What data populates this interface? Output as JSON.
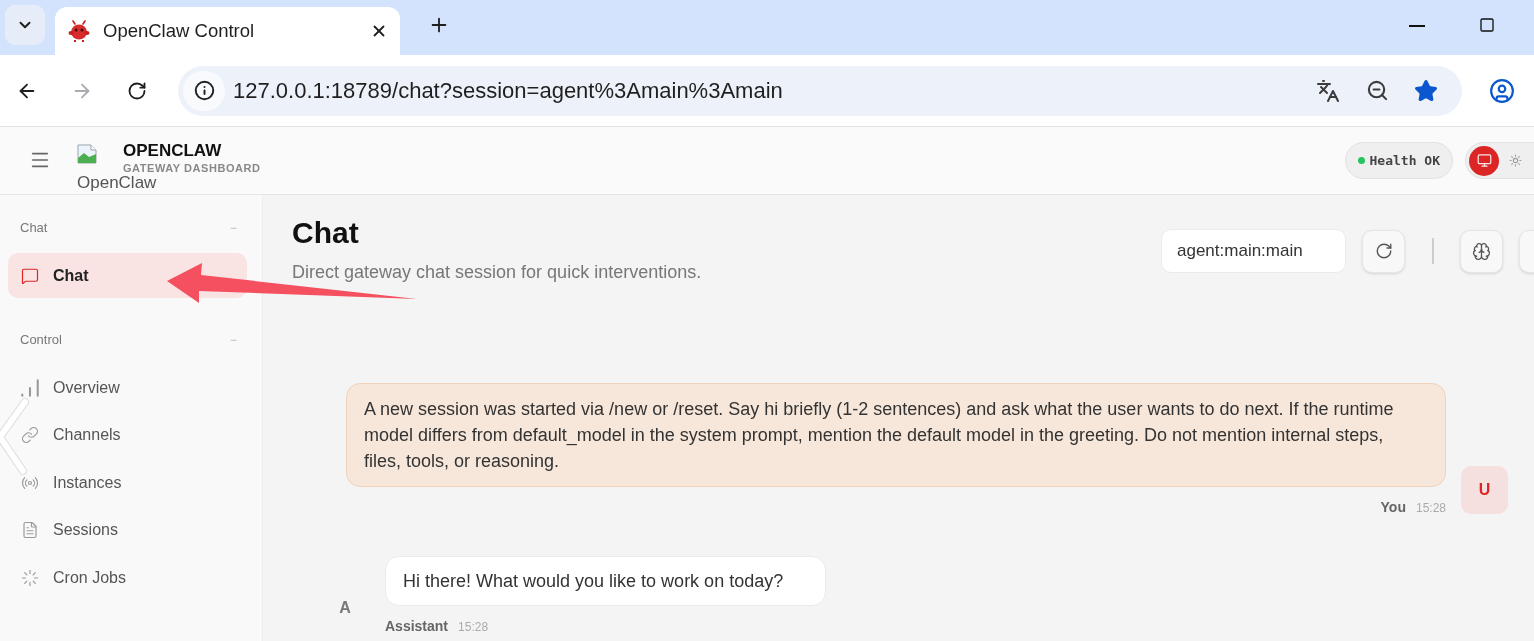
{
  "browser": {
    "tab": {
      "title": "OpenClaw Control"
    },
    "url": "127.0.0.1:18789/chat?session=agent%3Amain%3Amain",
    "forward_disabled": true,
    "bookmarked": true
  },
  "header": {
    "logo_alt": "OpenClaw",
    "brand": "OPENCLAW",
    "subtitle": "GATEWAY DASHBOARD",
    "health": {
      "label": "Health OK",
      "ok": true
    },
    "theme_modes": [
      {
        "kind": "system",
        "selected": true
      },
      {
        "kind": "light",
        "selected": false
      }
    ]
  },
  "sidebar": {
    "sections": [
      {
        "label": "Chat",
        "toggle": "−",
        "items": [
          {
            "label": "Chat",
            "kind": "chat",
            "selected": true
          }
        ]
      },
      {
        "label": "Control",
        "toggle": "−",
        "items": [
          {
            "label": "Overview",
            "kind": "overview",
            "selected": false
          },
          {
            "label": "Channels",
            "kind": "channels",
            "selected": false
          },
          {
            "label": "Instances",
            "kind": "instances",
            "selected": false
          },
          {
            "label": "Sessions",
            "kind": "sessions",
            "selected": false
          },
          {
            "label": "Cron Jobs",
            "kind": "cron",
            "selected": false
          }
        ]
      }
    ]
  },
  "chat": {
    "title": "Chat",
    "subtitle": "Direct gateway chat session for quick interventions.",
    "session": "agent:main:main",
    "messages": [
      {
        "kind": "user",
        "avatar": "U",
        "text": "A new session was started via /new or /reset. Say hi briefly (1-2 sentences) and ask what the user wants to do next. If the runtime model differs from default_model in the system prompt, mention the default model in the greeting. Do not mention internal steps, files, tools, or reasoning.",
        "author": "You",
        "time": "15:28"
      },
      {
        "kind": "assistant",
        "avatar": "A",
        "text": "Hi there! What would you like to work on today?",
        "author": "Assistant",
        "time": "15:28"
      }
    ]
  }
}
